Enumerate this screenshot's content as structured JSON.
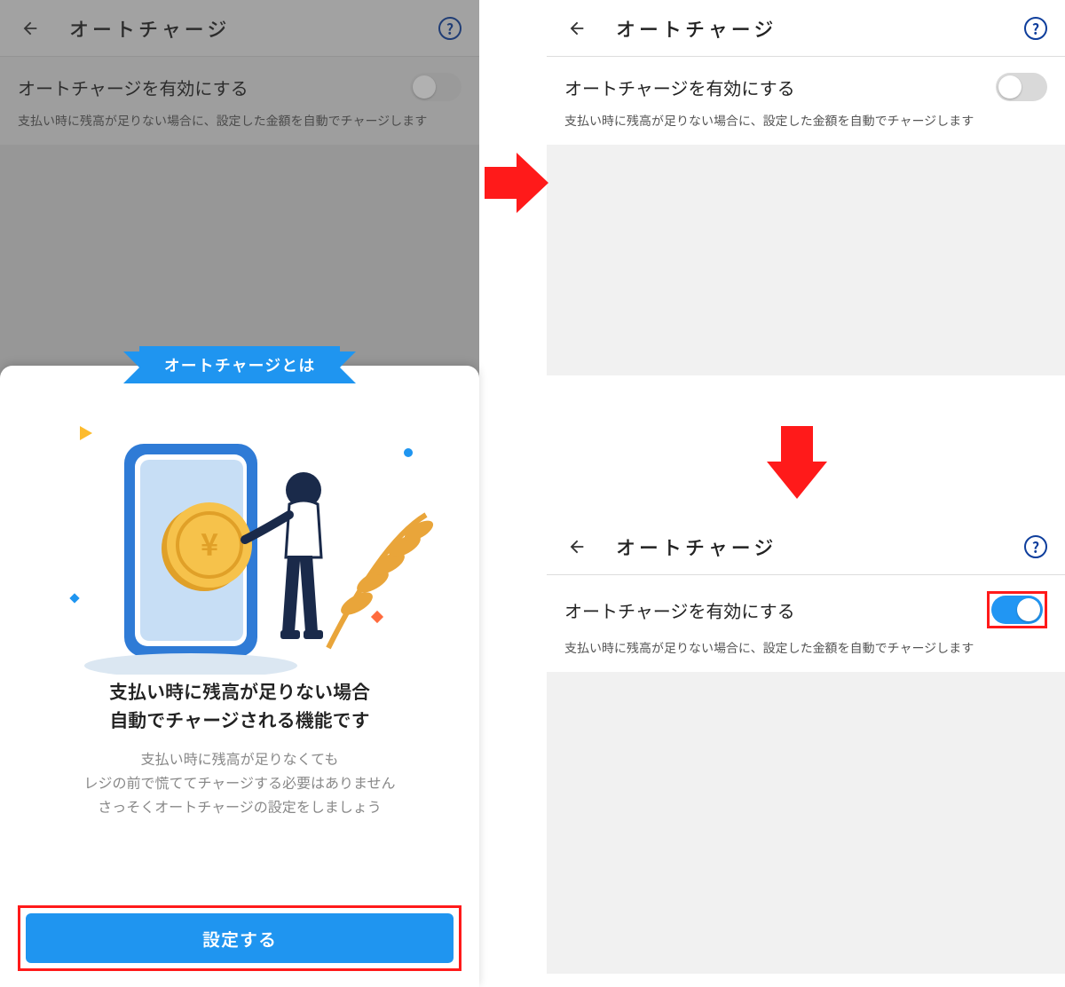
{
  "header": {
    "title": "オートチャージ",
    "help_symbol": "?"
  },
  "toggle": {
    "label": "オートチャージを有効にする",
    "desc": "支払い時に残高が足りない場合に、設定した金額を自動でチャージします"
  },
  "popup": {
    "ribbon": "オートチャージとは",
    "headline_line1": "支払い時に残高が足りない場合",
    "headline_line2": "自動でチャージされる機能です",
    "sub_line1": "支払い時に残高が足りなくても",
    "sub_line2": "レジの前で慌ててチャージする必要はありません",
    "sub_line3": "さっそくオートチャージの設定をしましょう",
    "cta": "設定する"
  },
  "colors": {
    "brand_blue": "#1f95f0",
    "help_blue": "#0e3e9c",
    "highlight_red": "#ff1a1a",
    "toggle_on": "#2196f3",
    "toggle_off": "#d9d9d9"
  }
}
